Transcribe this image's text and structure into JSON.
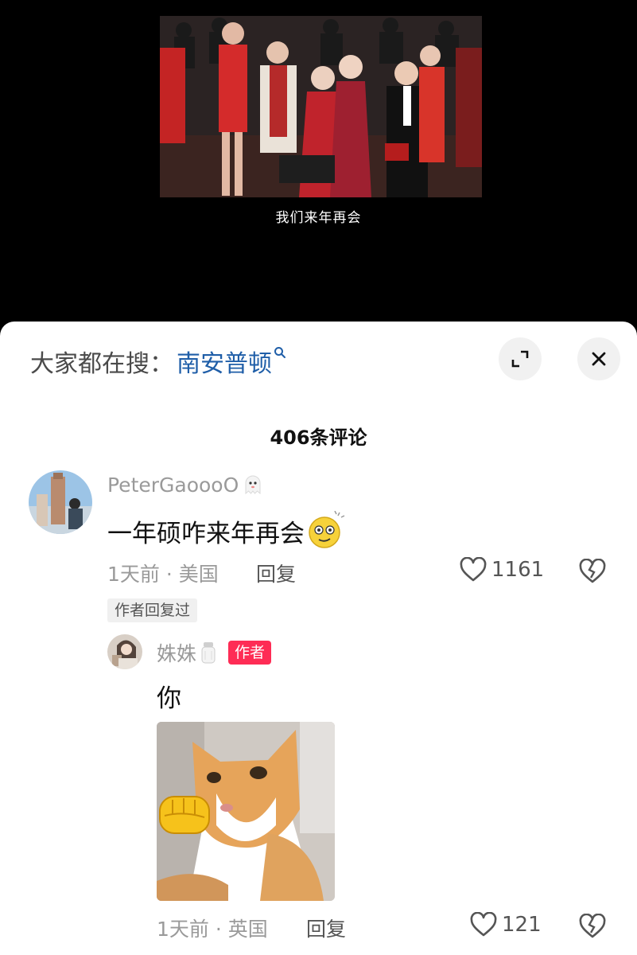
{
  "video": {
    "subtitle": "我们来年再会"
  },
  "search_bar": {
    "prefix": "大家都在搜：",
    "term": "南安普顿",
    "icon": "search-icon"
  },
  "controls": {
    "expand_icon": "expand-icon",
    "close_icon": "close-icon"
  },
  "comments_header": {
    "count_label": "406条评论"
  },
  "comment": {
    "username": "PeterGaoooO",
    "username_icon": "ghost-emoji-icon",
    "text": "一年硕咋来年再会",
    "text_emoji": "dizzy-face-emoji-icon",
    "time_location": "1天前 · 美国",
    "reply_label": "回复",
    "like_count": "1161",
    "author_replied_tag": "作者回复过"
  },
  "reply": {
    "username": "姝姝",
    "username_icon": "salt-shaker-emoji-icon",
    "author_badge": "作者",
    "text": "你",
    "image": "cat-fist-sticker-image",
    "time_location": "1天前 · 英国",
    "reply_label": "回复",
    "like_count": "121"
  },
  "colors": {
    "link_blue": "#1f5ea8",
    "author_badge_red": "#fe2c55",
    "meta_gray": "#9a9a9a"
  }
}
